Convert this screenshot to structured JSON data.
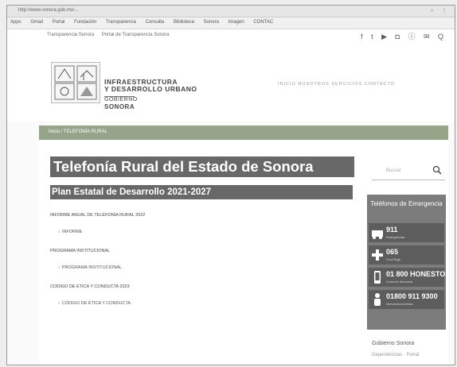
{
  "browser": {
    "url": "http://www.sonora.gob.mx/...",
    "tools": "☆ ⋮"
  },
  "bookmarks": [
    "Apps",
    "Gmail",
    "Portal",
    "Fundación",
    "Transparencia",
    "Consulta",
    "Biblioteca",
    "Sonora",
    "Imagen",
    "CONTAC"
  ],
  "topbar": {
    "left": [
      "Transparencia Sonora",
      "Portal de Transparencia Sonora"
    ],
    "social": "f t ▶ ◘ ⓘ ✉ Q"
  },
  "header": {
    "logo_line1": "INFRAESTRUCTURA",
    "logo_line2": "Y DESARROLLO URBANO",
    "logo_gob": "GOBIERNO",
    "logo_state": "SONORA",
    "nav": "INICIO  NOSOTROS  SERVICIOS  CONTACTO"
  },
  "breadcrumb": "Inicio / TELEFONÍA RURAL",
  "main": {
    "title": "Telefonía Rural del Estado de Sonora",
    "subtitle": "Plan Estatal de Desarrollo 2021-2027",
    "docs": [
      {
        "label": "INFORME ANUAL DE TELEFONÍA RURAL 2022",
        "link": "INFORME"
      },
      {
        "label": "PROGRAMA INSTITUCIONAL",
        "link": "PROGRAMA INSTITUCIONAL"
      },
      {
        "label": "CODIGO DE ETICA Y CONDUCTA 2023",
        "link": "CÓDIGO DE ÉTICA Y CONDUCTA"
      }
    ]
  },
  "sidebar": {
    "search_placeholder": "Buscar",
    "emergency_title": "Teléfonos de Emergencia",
    "emergency": [
      {
        "num": "911",
        "desc": "Emergencias"
      },
      {
        "num": "065",
        "desc": "Cruz Roja"
      },
      {
        "num": "01 800 HONESTO",
        "desc": "Línea de denuncia"
      },
      {
        "num": "01800 911 9300",
        "desc": "Denuncia anónima"
      }
    ],
    "links_title": "Gobierno  Sonora",
    "links_sub": "Dependencias · Portal"
  }
}
